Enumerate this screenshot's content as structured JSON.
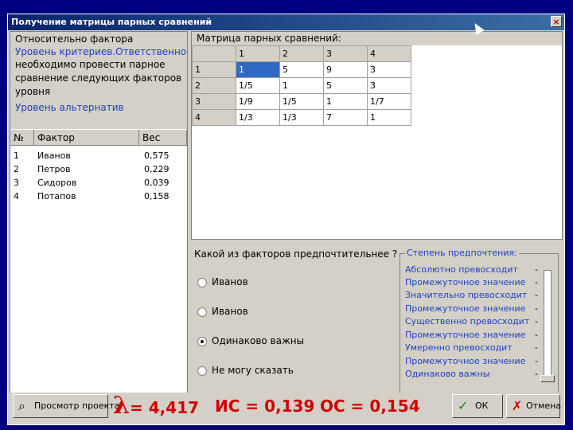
{
  "window": {
    "title": "Получение матрицы парных сравнений",
    "close_glyph": "×"
  },
  "left": {
    "relative_label": "Относительно фактора",
    "level_criteria": "Уровень критериев.Ответственность",
    "instruction_lines": [
      "необходимо провести парное",
      "сравнение следующих факторов",
      "уровня"
    ],
    "level_alternatives": "Уровень альтернатив",
    "columns": [
      "№",
      "Фактор",
      "Вес"
    ],
    "rows": [
      {
        "n": "1",
        "name": "Иванов",
        "weight": "0,575"
      },
      {
        "n": "2",
        "name": "Петров",
        "weight": "0,229"
      },
      {
        "n": "3",
        "name": "Сидоров",
        "weight": "0,039"
      },
      {
        "n": "4",
        "name": "Потапов",
        "weight": "0,158"
      }
    ]
  },
  "matrix": {
    "label": "Матрица парных сравнений:",
    "col_headers": [
      "1",
      "2",
      "3",
      "4"
    ],
    "rows": [
      {
        "header": "1",
        "cells": [
          "1",
          "5",
          "9",
          "3"
        ]
      },
      {
        "header": "2",
        "cells": [
          "1/5",
          "1",
          "5",
          "3"
        ]
      },
      {
        "header": "3",
        "cells": [
          "1/9",
          "1/5",
          "1",
          "1/7"
        ]
      },
      {
        "header": "4",
        "cells": [
          "1/3",
          "1/3",
          "7",
          "1"
        ]
      }
    ]
  },
  "question": {
    "text": "Какой из факторов предпочтительнее ?",
    "options": [
      {
        "label": "Иванов",
        "selected": false
      },
      {
        "label": "Иванов",
        "selected": false
      },
      {
        "label": "Одинаково важны",
        "selected": true
      },
      {
        "label": "Не могу сказать",
        "selected": false
      }
    ]
  },
  "preference": {
    "title": "Степень предпочтения:",
    "items": [
      "Абсолютно превосходит",
      "Промежуточное значение",
      "Значительно превосходит",
      "Промежуточное значение",
      "Существенно превосходит",
      "Промежуточное значение",
      "Умеренно превосходит",
      "Промежуточное значение",
      "Одинаково важны"
    ],
    "dash": "-"
  },
  "status": {
    "view_button": "Просмотр проекта",
    "lambda_symbol": "λ",
    "lambda_value": "= 4,417",
    "is_value": "ИС = 0,139",
    "os_value": "ОС = 0,154",
    "ok_button": "ОК",
    "cancel_button": "Отмена"
  },
  "colors": {
    "accent": "#0a246a",
    "metric": "#d00000",
    "link_blue": "#1c3fbf",
    "selected_cell": "#316ac5"
  }
}
